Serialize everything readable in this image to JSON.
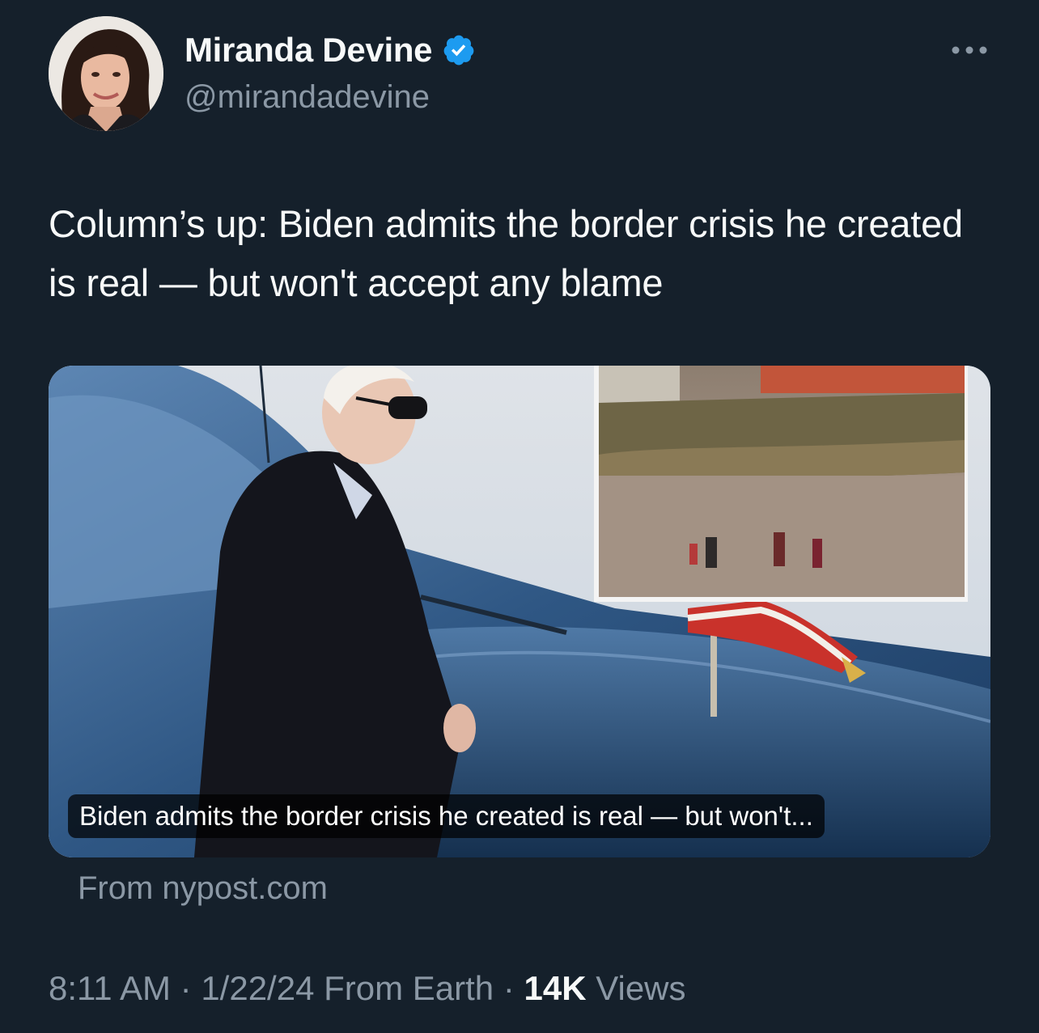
{
  "author": {
    "display_name": "Miranda Devine",
    "handle": "@mirandadevine",
    "verified": true
  },
  "tweet": {
    "text": "Column’s up: Biden admits the border crisis he created is real — but won't accept any blame"
  },
  "card": {
    "caption": "Biden admits the border crisis he created is real — but won't...",
    "source": "From nypost.com"
  },
  "meta": {
    "time": "8:11 AM",
    "separator": " · ",
    "date": "1/22/24",
    "client": "From Earth",
    "views_count": "14K",
    "views_label": "Views"
  },
  "icons": {
    "verified": "verified-badge-icon",
    "more": "more-options-icon"
  },
  "colors": {
    "background": "#15202b",
    "primary_text": "#f7f9f9",
    "secondary_text": "#8b98a5",
    "verified_blue": "#1d9bf0"
  }
}
